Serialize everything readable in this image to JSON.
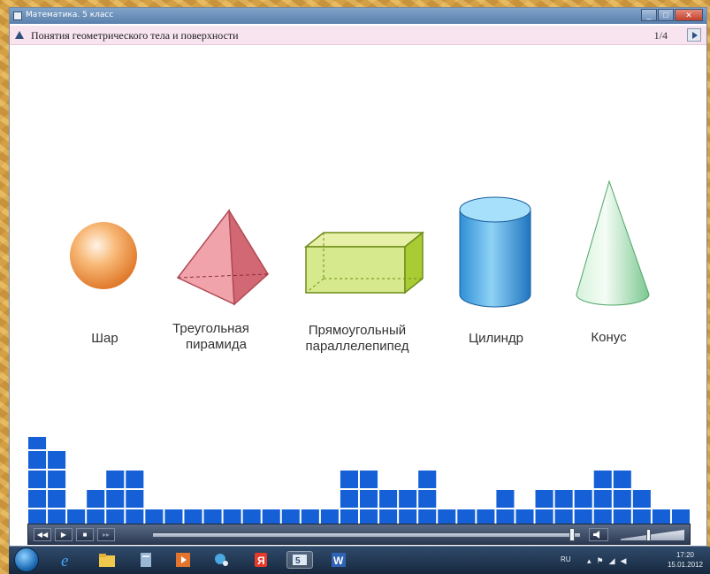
{
  "window": {
    "title": "Математика. 5 класс"
  },
  "lesson": {
    "title": "Понятия геометрического тела и поверхности",
    "page": "1/4"
  },
  "shapes": [
    {
      "id": "sphere",
      "label_lines": [
        "Шар"
      ]
    },
    {
      "id": "pyramid",
      "label_lines": [
        "Треугольная",
        "пирамида"
      ]
    },
    {
      "id": "box",
      "label_lines": [
        "Прямоугольный",
        "параллелепипед"
      ]
    },
    {
      "id": "cylinder",
      "label_lines": [
        "Цилиндр"
      ]
    },
    {
      "id": "cone",
      "label_lines": [
        "Конус"
      ]
    }
  ],
  "equalizer": {
    "color": "#1560d6",
    "levels": [
      5,
      4,
      1,
      2,
      3,
      3,
      1,
      1,
      1,
      1,
      1,
      1,
      1,
      1,
      1,
      1,
      3,
      3,
      2,
      2,
      3,
      1,
      1,
      1,
      2,
      1,
      2,
      2,
      2,
      3,
      3,
      2,
      1,
      1
    ]
  },
  "player": {
    "buttons": [
      {
        "id": "rewind",
        "glyph": "◀◀"
      },
      {
        "id": "play",
        "glyph": "▶"
      },
      {
        "id": "stop",
        "glyph": "■"
      },
      {
        "id": "forward",
        "glyph": "▸▸"
      }
    ],
    "progress": 0.98,
    "volume": 0.45,
    "volume_icon": "speaker-icon"
  },
  "taskbar": {
    "apps": [
      "ie-icon",
      "explorer-icon",
      "document-icon",
      "media-player-icon",
      "paint-icon",
      "yandex-icon",
      "presentation-icon",
      "word-icon"
    ],
    "active_app": "presentation-icon",
    "language": "RU",
    "time": "17:20",
    "date": "15.01.2012"
  },
  "colors": {
    "sphere": "#f5a15a",
    "pyramid": "#e9848c",
    "box": "#c9e07a",
    "cylinder": "#43a6e6",
    "cone": "#9ad8a8"
  }
}
